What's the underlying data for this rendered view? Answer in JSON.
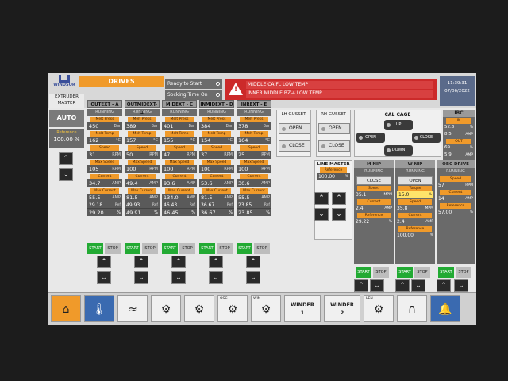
{
  "header": {
    "logo_text": "WINDSOR",
    "extruder_label_1": "EXTRUDER",
    "extruder_label_2": "MASTER",
    "drives_title": "DRIVES",
    "ready_to_start": "Ready to Start",
    "socking_time": "Socking Time On",
    "alarms": [
      "MIDDLE CA.FL LOW TEMP",
      "INNER MIDDLE BZ-4 LOW TEMP"
    ],
    "time": "11:39:31",
    "date": "07/06/2022"
  },
  "master": {
    "mode": "AUTO",
    "reference_label": "Reference",
    "reference_value": "100.00 %"
  },
  "labels": {
    "running": "RUNNING",
    "melt_press": "Melt Press",
    "melt_temp": "Melt Temp",
    "speed": "Speed",
    "max_speed": "Max Speed",
    "current": "Current",
    "max_current": "Max Current",
    "ref": "Ref",
    "start": "START",
    "stop": "STOP",
    "reference": "Reference",
    "torque": "Torque",
    "open": "OPEN",
    "close": "CLOSE",
    "up": "UP",
    "down": "DOWN",
    "in": "IN",
    "out": "OUT"
  },
  "units": {
    "bar": "Bar",
    "degc": "°C",
    "rpm": "RPM",
    "amp": "AMP",
    "mpm": "MPM",
    "pct": "%"
  },
  "drives": [
    {
      "name": "OUTEXT - A",
      "melt_press": "450",
      "melt_temp": "162",
      "speed": "31",
      "max_speed": "105",
      "current": "34.7",
      "max_current": "55.5",
      "ref": "29.18",
      "pct": "29.20"
    },
    {
      "name": "OUTMIDEXT-B",
      "melt_press": "389",
      "melt_temp": "157",
      "speed": "50",
      "max_speed": "100",
      "current": "49.4",
      "max_current": "81.5",
      "ref": "49.93",
      "pct": "49.91"
    },
    {
      "name": "MIDEXT - C",
      "melt_press": "401",
      "melt_temp": "155",
      "speed": "47",
      "max_speed": "100",
      "current": "93.6",
      "max_current": "134.0",
      "ref": "46.43",
      "pct": "46.45"
    },
    {
      "name": "INMIDEXT - D",
      "melt_press": "384",
      "melt_temp": "154",
      "speed": "37",
      "max_speed": "100",
      "current": "53.6",
      "max_current": "81.5",
      "ref": "36.67",
      "pct": "36.67"
    },
    {
      "name": "INREXT - E",
      "melt_press": "378",
      "melt_temp": "164",
      "speed": "25",
      "max_speed": "100",
      "current": "30.6",
      "max_current": "55.5",
      "ref": "23.85",
      "pct": "23.85"
    }
  ],
  "gussets": {
    "lh_title": "LH GUSSET",
    "rh_title": "RH GUSSET"
  },
  "cal_cage": {
    "title": "CAL CAGE"
  },
  "ibc": {
    "title": "IBC",
    "in_values": [
      "52.8",
      "8.5"
    ],
    "out_values": [
      "69",
      "5.9"
    ],
    "in_units": [
      "%",
      "AMP"
    ],
    "out_units": [
      "%",
      "AMP"
    ]
  },
  "line_master": {
    "title": "LINE MASTER",
    "reference": "100.00"
  },
  "nips": [
    {
      "title": "M NIP",
      "state": "CLOSE",
      "speed": "35.1",
      "current": "2.4",
      "reference": "29.22"
    },
    {
      "title": "W NIP",
      "state": "OPEN",
      "torque": "15.0",
      "speed": "35.8",
      "current": "2.4",
      "reference": "100.00"
    }
  ],
  "obc": {
    "title": "OBC DRIVE",
    "speed": "57",
    "current": "14",
    "reference": "57.00"
  },
  "footer": {
    "osc": "OSC",
    "win": "WIN",
    "len": "LEN",
    "winder1_a": "WINDER",
    "winder1_b": "1",
    "winder2_a": "WINDER",
    "winder2_b": "2"
  }
}
